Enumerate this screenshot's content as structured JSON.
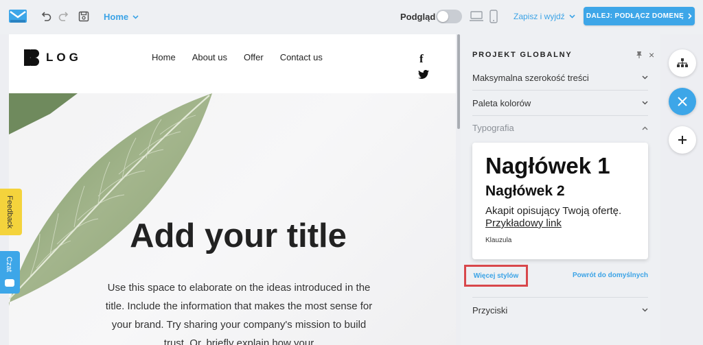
{
  "topbar": {
    "page_select": "Home",
    "preview_label": "Podgląd",
    "save_exit": "Zapisz i wyjdź",
    "next_button": "DALEJ: PODŁĄCZ DOMENĘ"
  },
  "site": {
    "brand": "LOG",
    "nav": [
      "Home",
      "About us",
      "Offer",
      "Contact us"
    ],
    "social_fb": "f",
    "hero_title": "Add your title",
    "hero_text": "Use this space to elaborate on the ideas introduced in the title. Include the information that makes the most sense for your brand. Try sharing your company's mission to build trust. Or, briefly explain how your"
  },
  "side_tabs": {
    "feedback": "Feedback",
    "chat": "Czat"
  },
  "panel": {
    "title": "PROJEKT GLOBALNY",
    "close": "×",
    "sections": {
      "max_width": "Maksymalna szerokość treści",
      "palette": "Paleta kolorów",
      "typography": "Typografia",
      "buttons": "Przyciski"
    },
    "typography_preview": {
      "h1": "Nagłówek 1",
      "h2": "Nagłówek 2",
      "paragraph": "Akapit opisujący Twoją ofertę.",
      "link": "Przykładowy link",
      "clause": "Klauzula"
    },
    "more_styles": "Więcej stylów",
    "reset": "Powrót do domyślnych"
  },
  "colors": {
    "accent": "#3da6e8",
    "highlight": "#d8474b",
    "feedback": "#f4d33c"
  }
}
